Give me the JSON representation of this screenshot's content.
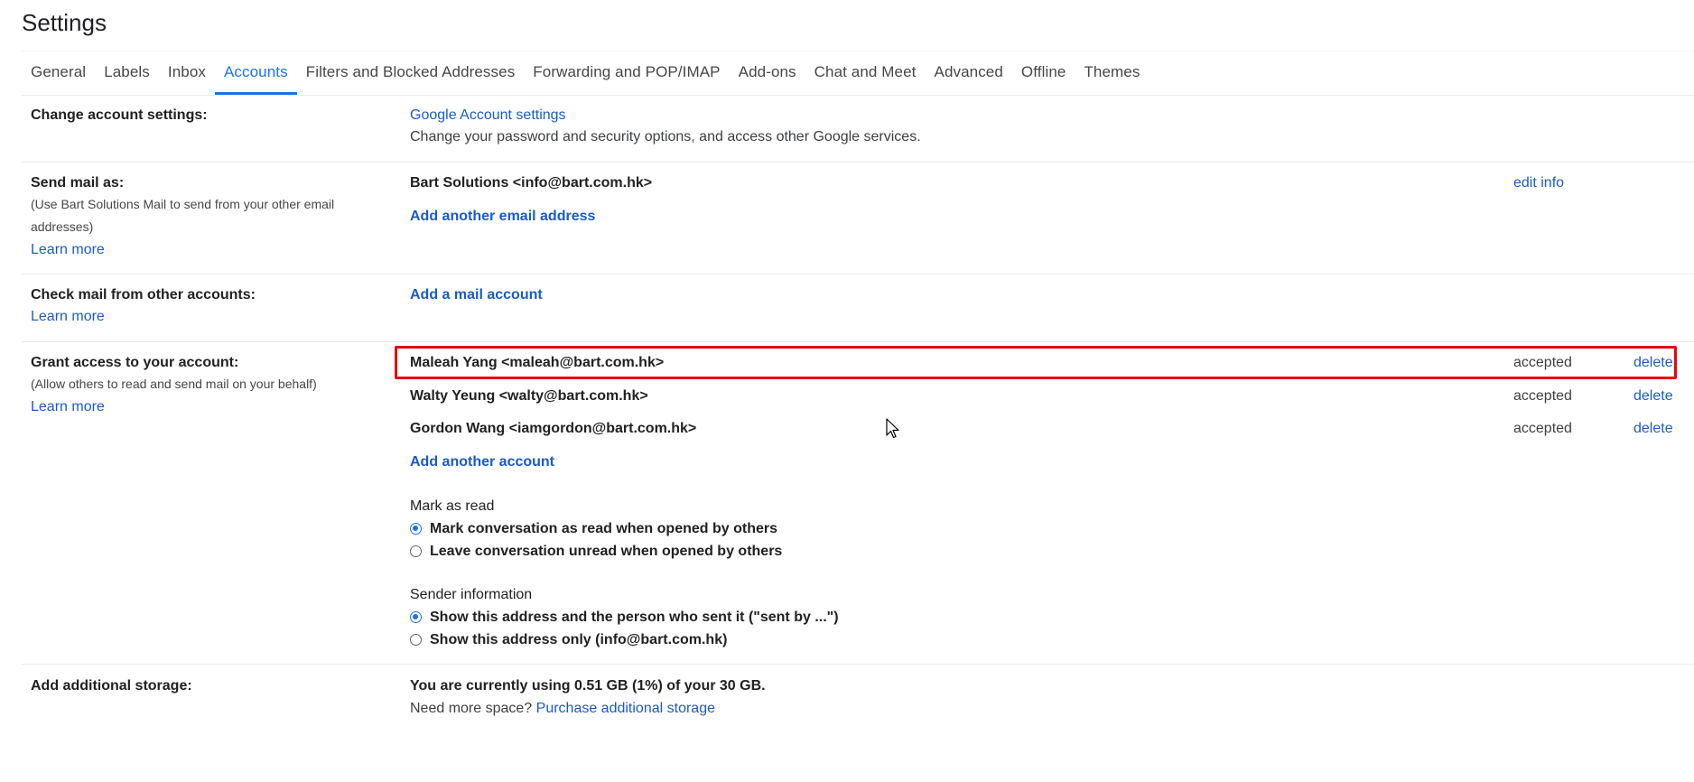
{
  "page": {
    "title": "Settings"
  },
  "tabs": [
    {
      "label": "General",
      "active": false
    },
    {
      "label": "Labels",
      "active": false
    },
    {
      "label": "Inbox",
      "active": false
    },
    {
      "label": "Accounts",
      "active": true
    },
    {
      "label": "Filters and Blocked Addresses",
      "active": false
    },
    {
      "label": "Forwarding and POP/IMAP",
      "active": false
    },
    {
      "label": "Add-ons",
      "active": false
    },
    {
      "label": "Chat and Meet",
      "active": false
    },
    {
      "label": "Advanced",
      "active": false
    },
    {
      "label": "Offline",
      "active": false
    },
    {
      "label": "Themes",
      "active": false
    }
  ],
  "change_account": {
    "label": "Change account settings:",
    "link": "Google Account settings",
    "desc": "Change your password and security options, and access other Google services."
  },
  "send_mail": {
    "label": "Send mail as:",
    "desc": "(Use Bart Solutions Mail to send from your other email addresses)",
    "learn_more": "Learn more",
    "address": "Bart Solutions <info@bart.com.hk>",
    "edit_info": "edit info",
    "add_link": "Add another email address"
  },
  "check_mail": {
    "label": "Check mail from other accounts:",
    "learn_more": "Learn more",
    "add_link": "Add a mail account"
  },
  "grant_access": {
    "label": "Grant access to your account:",
    "desc": "(Allow others to read and send mail on your behalf)",
    "learn_more": "Learn more",
    "accounts": [
      {
        "name": "Maleah Yang <maleah@bart.com.hk>",
        "status": "accepted",
        "action": "delete"
      },
      {
        "name": "Walty Yeung <walty@bart.com.hk>",
        "status": "accepted",
        "action": "delete"
      },
      {
        "name": "Gordon Wang <iamgordon@bart.com.hk>",
        "status": "accepted",
        "action": "delete"
      }
    ],
    "add_link": "Add another account",
    "mark_as_read": {
      "heading": "Mark as read",
      "options": [
        {
          "label": "Mark conversation as read when opened by others",
          "checked": true
        },
        {
          "label": "Leave conversation unread when opened by others",
          "checked": false
        }
      ]
    },
    "sender_info": {
      "heading": "Sender information",
      "options": [
        {
          "label": "Show this address and the person who sent it (\"sent by ...\")",
          "checked": true
        },
        {
          "label": "Show this address only (info@bart.com.hk)",
          "checked": false
        }
      ]
    }
  },
  "storage": {
    "label": "Add additional storage:",
    "usage": "You are currently using 0.51 GB (1%) of your 30 GB.",
    "need_more": "Need more space?",
    "purchase_link": "Purchase additional storage"
  },
  "colors": {
    "accent": "#1a73e8",
    "link": "#1a5bc4",
    "highlight": "#e30613"
  }
}
